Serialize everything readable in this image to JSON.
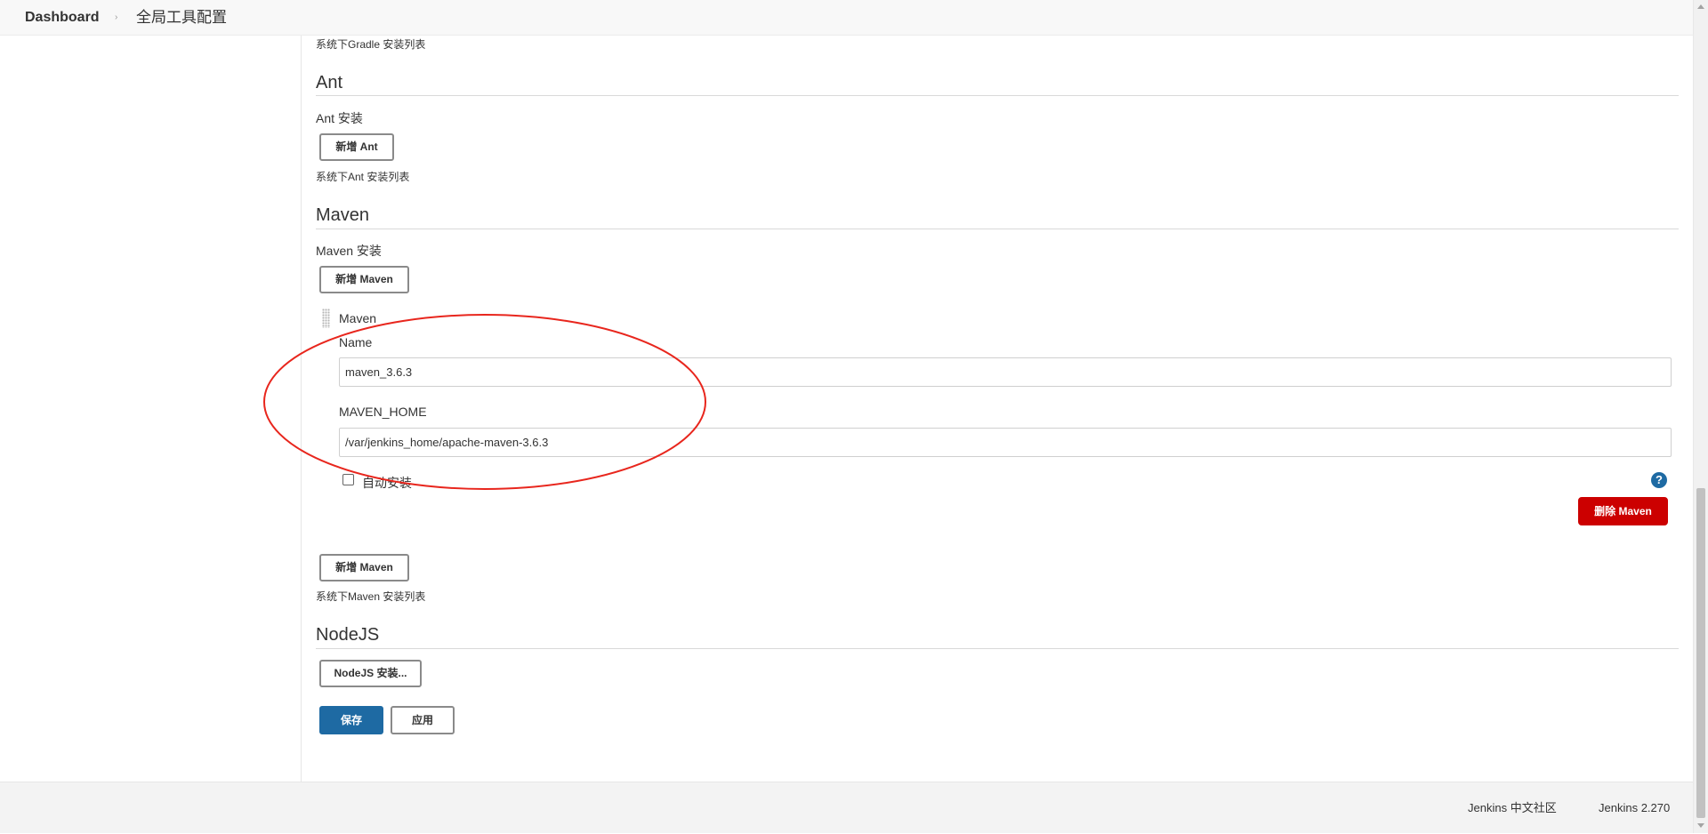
{
  "breadcrumb": {
    "home": "Dashboard",
    "separator": "›",
    "current": "全局工具配置"
  },
  "gradle": {
    "list_note": "系统下Gradle 安装列表"
  },
  "ant": {
    "title": "Ant",
    "install_label": "Ant 安装",
    "add_button": "新增 Ant",
    "list_note": "系统下Ant 安装列表"
  },
  "maven": {
    "title": "Maven",
    "install_label": "Maven 安装",
    "add_button_top": "新增 Maven",
    "item": {
      "header": "Maven",
      "name_label": "Name",
      "name_value": "maven_3.6.3",
      "home_label": "MAVEN_HOME",
      "home_value": "/var/jenkins_home/apache-maven-3.6.3",
      "auto_install_label": "自动安装",
      "auto_install_checked": false,
      "help": "?",
      "delete_button": "删除 Maven"
    },
    "add_button_bottom": "新增 Maven",
    "list_note": "系统下Maven 安装列表"
  },
  "nodejs": {
    "title": "NodeJS",
    "install_button": "NodeJS 安装..."
  },
  "actions": {
    "save": "保存",
    "apply": "应用"
  },
  "footer": {
    "community": "Jenkins 中文社区",
    "version": "Jenkins 2.270"
  },
  "colors": {
    "primary": "#1e6aa3",
    "danger": "#cc0000",
    "annotation": "#e8261d"
  }
}
